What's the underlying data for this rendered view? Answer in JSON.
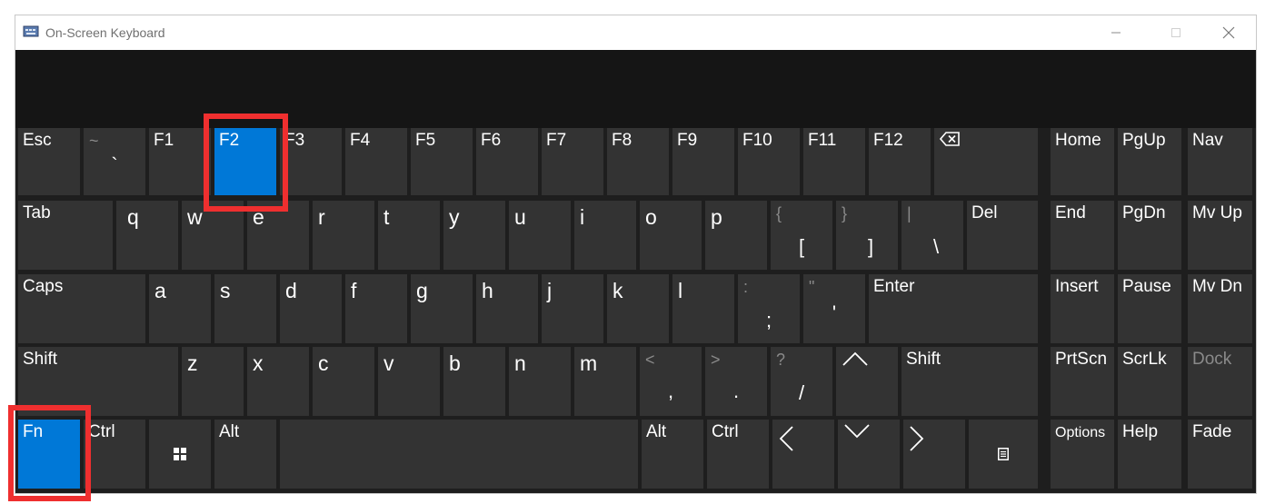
{
  "window": {
    "title": "On-Screen Keyboard"
  },
  "keys": {
    "esc": "Esc",
    "tilde_shift": "~",
    "tilde_main": "`",
    "f1": "F1",
    "f2": "F2",
    "f3": "F3",
    "f4": "F4",
    "f5": "F5",
    "f6": "F6",
    "f7": "F7",
    "f8": "F8",
    "f9": "F9",
    "f10": "F10",
    "f11": "F11",
    "f12": "F12",
    "home": "Home",
    "pgup": "PgUp",
    "nav": "Nav",
    "tab": "Tab",
    "q": "q",
    "w": "w",
    "e": "e",
    "r": "r",
    "t": "t",
    "y": "y",
    "u": "u",
    "i": "i",
    "o": "o",
    "p": "p",
    "lbrace_shift": "{",
    "lbrace_main": "[",
    "rbrace_shift": "}",
    "rbrace_main": "]",
    "pipe_shift": "|",
    "pipe_main": "\\",
    "del": "Del",
    "end": "End",
    "pgdn": "PgDn",
    "mvup": "Mv Up",
    "caps": "Caps",
    "a": "a",
    "s": "s",
    "d": "d",
    "f": "f",
    "g": "g",
    "h": "h",
    "j": "j",
    "k": "k",
    "l": "l",
    "colon_shift": ":",
    "colon_main": ";",
    "quote_shift": "\"",
    "quote_main": "'",
    "enter": "Enter",
    "insert": "Insert",
    "pause": "Pause",
    "mvdn": "Mv Dn",
    "shift_left": "Shift",
    "z": "z",
    "x": "x",
    "c": "c",
    "v": "v",
    "b": "b",
    "n": "n",
    "m": "m",
    "lt_shift": "<",
    "lt_main": ",",
    "gt_shift": ">",
    "gt_main": ".",
    "q_shift": "?",
    "q_main": "/",
    "shift_right": "Shift",
    "prtscn": "PrtScn",
    "scrlk": "ScrLk",
    "dock": "Dock",
    "fn": "Fn",
    "ctrl_left": "Ctrl",
    "alt_left": "Alt",
    "alt_right": "Alt",
    "ctrl_right": "Ctrl",
    "options": "Options",
    "help": "Help",
    "fade": "Fade"
  },
  "active_keys": [
    "F2",
    "Fn"
  ],
  "colors": {
    "active_key": "#0078d7",
    "key": "#333333",
    "highlight": "#ef2f2f"
  }
}
